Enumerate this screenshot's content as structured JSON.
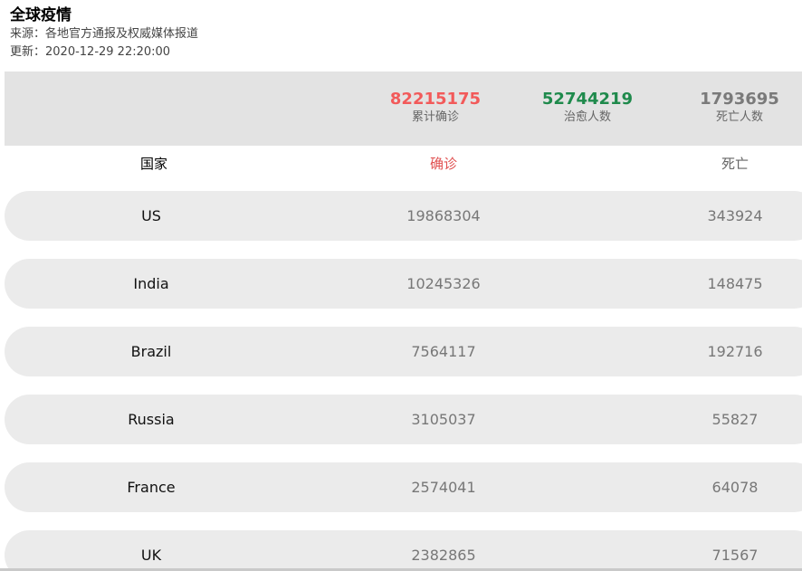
{
  "header": {
    "title": "全球疫情",
    "source": "来源：各地官方通报及权威媒体报道",
    "updated": "更新：2020-12-29 22:20:00"
  },
  "summary": {
    "confirmed": {
      "value": "82215175",
      "label": "累计确诊",
      "color": "#f25a5a"
    },
    "recovered": {
      "value": "52744219",
      "label": "治愈人数",
      "color": "#1f8a4c"
    },
    "deaths": {
      "value": "1793695",
      "label": "死亡人数",
      "color": "#7a7a7a"
    }
  },
  "table": {
    "columns": {
      "country": "国家",
      "confirmed": "确诊",
      "deaths": "死亡"
    },
    "rows": [
      {
        "country": "US",
        "confirmed": "19868304",
        "deaths": "343924"
      },
      {
        "country": "India",
        "confirmed": "10245326",
        "deaths": "148475"
      },
      {
        "country": "Brazil",
        "confirmed": "7564117",
        "deaths": "192716"
      },
      {
        "country": "Russia",
        "confirmed": "3105037",
        "deaths": "55827"
      },
      {
        "country": "France",
        "confirmed": "2574041",
        "deaths": "64078"
      },
      {
        "country": "UK",
        "confirmed": "2382865",
        "deaths": "71567"
      }
    ]
  }
}
